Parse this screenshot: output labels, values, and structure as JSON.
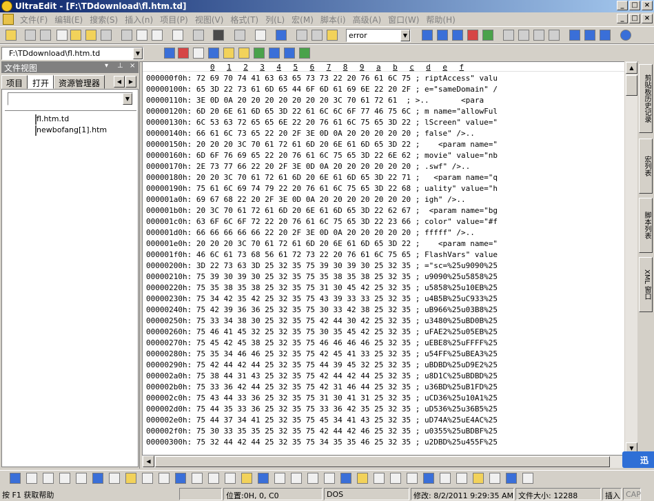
{
  "window": {
    "title": "UltraEdit - [F:\\TDdownload\\fl.htm.td]",
    "buttons": [
      "_",
      "□",
      "×"
    ]
  },
  "menu": [
    "文件(F)",
    "编辑(E)",
    "搜索(S)",
    "插入(n)",
    "项目(P)",
    "视图(V)",
    "格式(T)",
    "列(L)",
    "宏(M)",
    "脚本(i)",
    "高级(A)",
    "窗口(W)",
    "帮助(H)"
  ],
  "toolbar": {
    "search_value": "error",
    "path_value": "F:\\TDdownload\\fl.htm.td"
  },
  "file_view": {
    "title": "文件视图",
    "pin_label": "▾",
    "close_label": "×",
    "tabs": [
      "项目",
      "打开",
      "资源管理器"
    ],
    "active_tab": "打开",
    "files": [
      "fl.htm.td",
      "newbofang[1].htm"
    ]
  },
  "hex_editor": {
    "ruler": [
      "0",
      "1",
      "2",
      "3",
      "4",
      "5",
      "6",
      "7",
      "8",
      "9",
      "a",
      "b",
      "c",
      "d",
      "e",
      "f"
    ],
    "rows": [
      {
        "addr": "000000f0h:",
        "hex": "72 69 70 74 41 63 63 65 73 73 22 20 76 61 6C 75",
        "ascii": "riptAccess\" valu"
      },
      {
        "addr": "00000100h:",
        "hex": "65 3D 22 73 61 6D 65 44 6F 6D 61 69 6E 22 20 2F",
        "ascii": "e=\"sameDomain\" /"
      },
      {
        "addr": "00000110h:",
        "hex": "3E 0D 0A 20 20 20 20 20 20 20 3C 70 61 72 61 ",
        "ascii": ">..       <para"
      },
      {
        "addr": "00000120h:",
        "hex": "6D 20 6E 61 6D 65 3D 22 61 6C 6C 6F 77 46 75 6C",
        "ascii": "m name=\"allowFul"
      },
      {
        "addr": "00000130h:",
        "hex": "6C 53 63 72 65 65 6E 22 20 76 61 6C 75 65 3D 22",
        "ascii": "lScreen\" value=\""
      },
      {
        "addr": "00000140h:",
        "hex": "66 61 6C 73 65 22 20 2F 3E 0D 0A 20 20 20 20 20",
        "ascii": "false\" />..     "
      },
      {
        "addr": "00000150h:",
        "hex": "20 20 20 3C 70 61 72 61 6D 20 6E 61 6D 65 3D 22",
        "ascii": "   <param name=\""
      },
      {
        "addr": "00000160h:",
        "hex": "6D 6F 76 69 65 22 20 76 61 6C 75 65 3D 22 6E 62",
        "ascii": "movie\" value=\"nb"
      },
      {
        "addr": "00000170h:",
        "hex": "2E 73 77 66 22 20 2F 3E 0D 0A 20 20 20 20 20 20",
        "ascii": ".swf\" />..      "
      },
      {
        "addr": "00000180h:",
        "hex": "20 20 3C 70 61 72 61 6D 20 6E 61 6D 65 3D 22 71",
        "ascii": "  <param name=\"q"
      },
      {
        "addr": "00000190h:",
        "hex": "75 61 6C 69 74 79 22 20 76 61 6C 75 65 3D 22 68",
        "ascii": "uality\" value=\"h"
      },
      {
        "addr": "000001a0h:",
        "hex": "69 67 68 22 20 2F 3E 0D 0A 20 20 20 20 20 20 20",
        "ascii": "igh\" />..       "
      },
      {
        "addr": "000001b0h:",
        "hex": "20 3C 70 61 72 61 6D 20 6E 61 6D 65 3D 22 62 67",
        "ascii": " <param name=\"bg"
      },
      {
        "addr": "000001c0h:",
        "hex": "63 6F 6C 6F 72 22 20 76 61 6C 75 65 3D 22 23 66",
        "ascii": "color\" value=\"#f"
      },
      {
        "addr": "000001d0h:",
        "hex": "66 66 66 66 66 22 20 2F 3E 0D 0A 20 20 20 20 20",
        "ascii": "fffff\" />..     "
      },
      {
        "addr": "000001e0h:",
        "hex": "20 20 20 3C 70 61 72 61 6D 20 6E 61 6D 65 3D 22",
        "ascii": "   <param name=\""
      },
      {
        "addr": "000001f0h:",
        "hex": "46 6C 61 73 68 56 61 72 73 22 20 76 61 6C 75 65",
        "ascii": "FlashVars\" value"
      },
      {
        "addr": "00000200h:",
        "hex": "3D 22 73 63 3D 25 32 35 75 39 30 39 30 25 32 35",
        "ascii": "=\"sc=%25u9090%25"
      },
      {
        "addr": "00000210h:",
        "hex": "75 39 30 39 30 25 32 35 75 35 38 35 38 25 32 35",
        "ascii": "u9090%25u5858%25"
      },
      {
        "addr": "00000220h:",
        "hex": "75 35 38 35 38 25 32 35 75 31 30 45 42 25 32 35",
        "ascii": "u5858%25u10EB%25"
      },
      {
        "addr": "00000230h:",
        "hex": "75 34 42 35 42 25 32 35 75 43 39 33 33 25 32 35",
        "ascii": "u4B5B%25uC933%25"
      },
      {
        "addr": "00000240h:",
        "hex": "75 42 39 36 36 25 32 35 75 30 33 42 38 25 32 35",
        "ascii": "uB966%25u03B8%25"
      },
      {
        "addr": "00000250h:",
        "hex": "75 33 34 38 30 25 32 35 75 42 44 30 42 25 32 35",
        "ascii": "u3480%25uBD0B%25"
      },
      {
        "addr": "00000260h:",
        "hex": "75 46 41 45 32 25 32 35 75 30 35 45 42 25 32 35",
        "ascii": "uFAE2%25u05EB%25"
      },
      {
        "addr": "00000270h:",
        "hex": "75 45 42 45 38 25 32 35 75 46 46 46 46 25 32 35",
        "ascii": "uEBE8%25uFFFF%25"
      },
      {
        "addr": "00000280h:",
        "hex": "75 35 34 46 46 25 32 35 75 42 45 41 33 25 32 35",
        "ascii": "u54FF%25uBEA3%25"
      },
      {
        "addr": "00000290h:",
        "hex": "75 42 44 42 44 25 32 35 75 44 39 45 32 25 32 35",
        "ascii": "uBDBD%25uD9E2%25"
      },
      {
        "addr": "000002a0h:",
        "hex": "75 38 44 31 43 25 32 35 75 42 44 42 44 25 32 35",
        "ascii": "u8D1C%25uBDBD%25"
      },
      {
        "addr": "000002b0h:",
        "hex": "75 33 36 42 44 25 32 35 75 42 31 46 44 25 32 35",
        "ascii": "u36BD%25uB1FD%25"
      },
      {
        "addr": "000002c0h:",
        "hex": "75 43 44 33 36 25 32 35 75 31 30 41 31 25 32 35",
        "ascii": "uCD36%25u10A1%25"
      },
      {
        "addr": "000002d0h:",
        "hex": "75 44 35 33 36 25 32 35 75 33 36 42 35 25 32 35",
        "ascii": "uD536%25u36B5%25"
      },
      {
        "addr": "000002e0h:",
        "hex": "75 44 37 34 41 25 32 35 75 45 34 41 43 25 32 35",
        "ascii": "uD74A%25uE4AC%25"
      },
      {
        "addr": "000002f0h:",
        "hex": "75 30 33 35 35 25 32 35 75 42 44 42 46 25 32 35",
        "ascii": "u0355%25uBDBF%25"
      },
      {
        "addr": "00000300h:",
        "hex": "75 32 44 42 44 25 32 35 75 34 35 35 46 25 32 35",
        "ascii": "u2DBD%25u455F%25"
      }
    ]
  },
  "side_tabs": [
    "剪贴板历史记录",
    "宏列表",
    "脚本列表",
    "XML 窗口"
  ],
  "corner_badge": "迅",
  "status": {
    "help": "按 F1 获取帮助",
    "position": "位置:0H, 0, C0",
    "format": "DOS",
    "modified": "修改:  8/2/2011 9:29:35 AM",
    "filesize": "文件大小: 12288",
    "insert": "插入",
    "caps": "CAP"
  },
  "colors": {
    "title_start": "#0a246a",
    "title_end": "#a6caf0",
    "face": "#d4d0c8"
  }
}
